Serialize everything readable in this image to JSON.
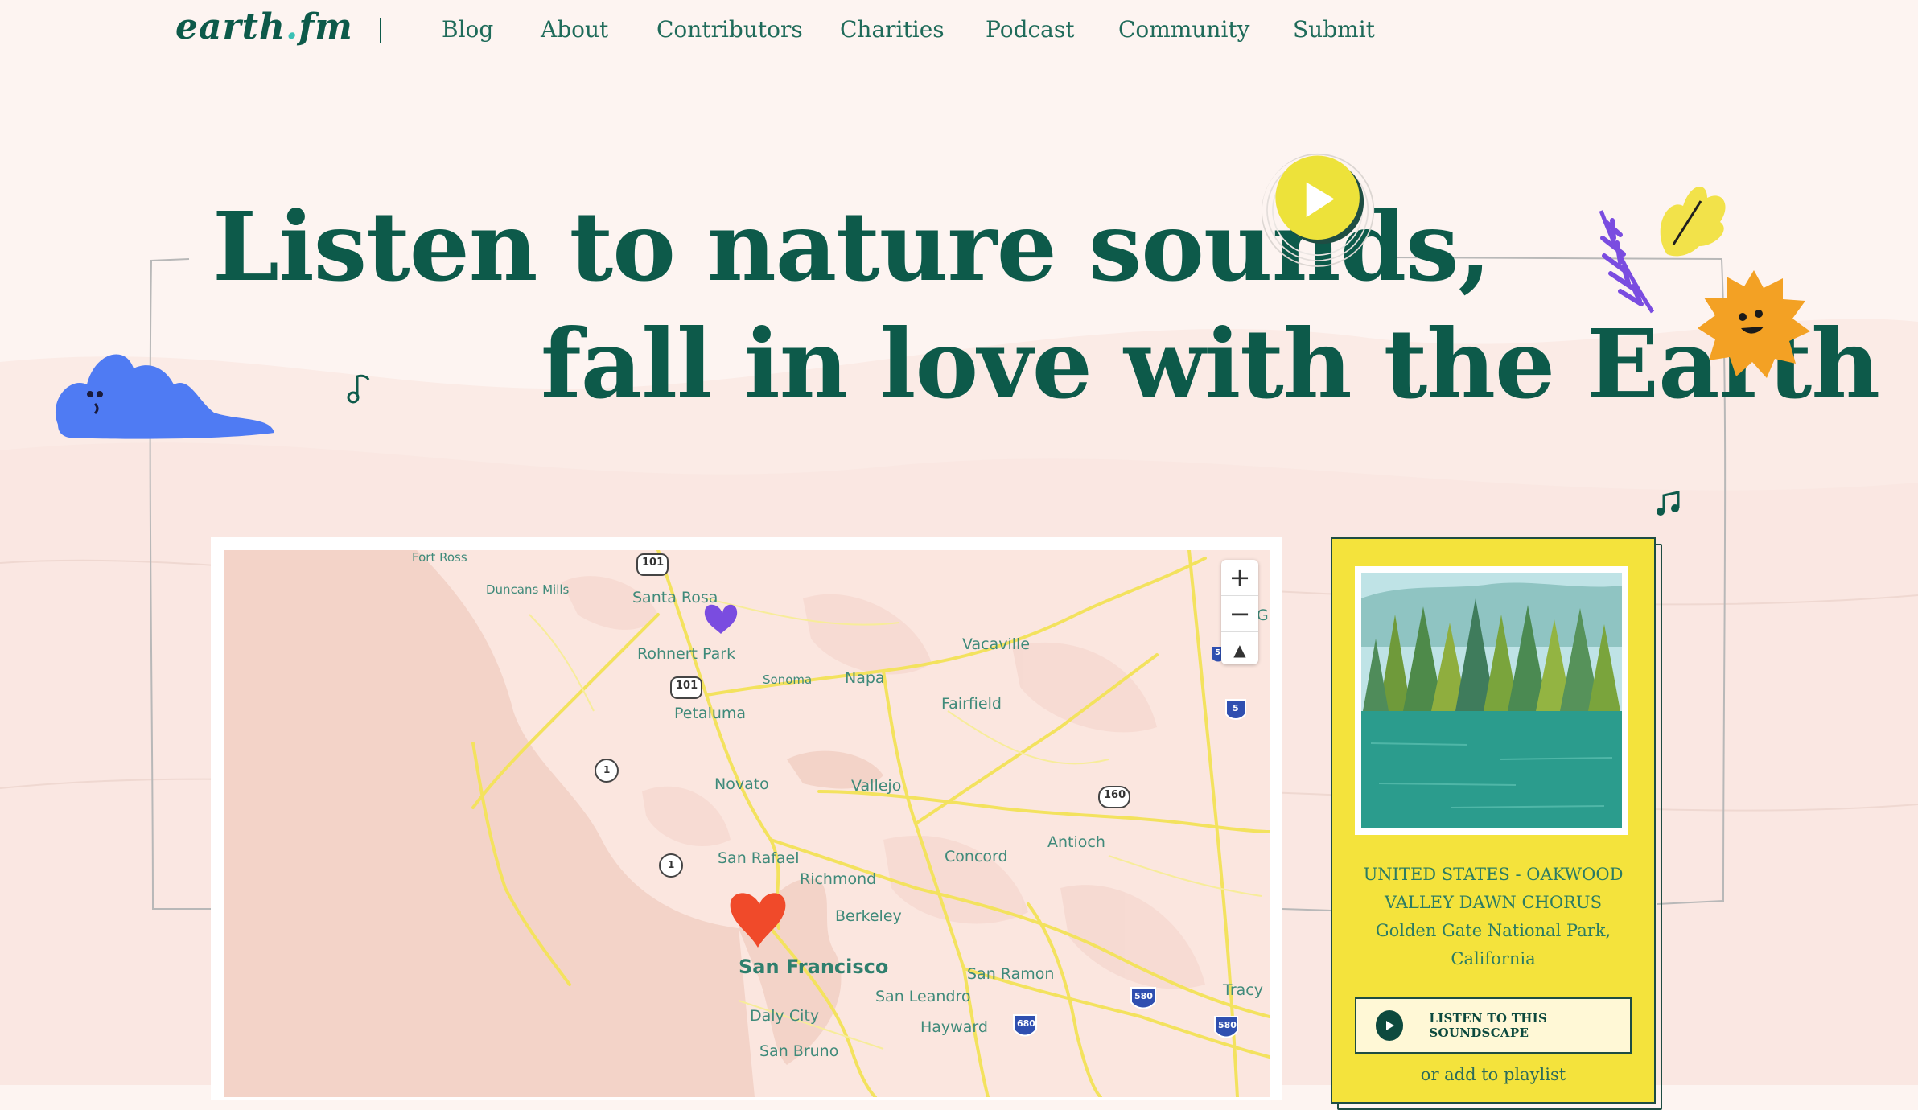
{
  "nav": {
    "logo_main": "earth",
    "logo_dot": ".",
    "logo_tail": "fm",
    "links": [
      "Blog",
      "About",
      "Contributors",
      "Charities",
      "Podcast",
      "Community",
      "Submit"
    ]
  },
  "hero": {
    "line1": "Listen to nature sounds,",
    "line2": "fall in love with the Earth"
  },
  "map": {
    "labels": [
      "Fort Ross",
      "Duncans Mills",
      "Santa Rosa",
      "Rohnert Park",
      "Sonoma",
      "Napa",
      "Vacaville",
      "Petaluma",
      "Fairfield",
      "Novato",
      "Vallejo",
      "Antioch",
      "San Rafael",
      "Richmond",
      "Concord",
      "Berkeley",
      "San Francisco",
      "San Ramon",
      "San Leandro",
      "Daly City",
      "Hayward",
      "Tracy",
      "San Bruno",
      "Gr"
    ],
    "shields": [
      "101",
      "101",
      "1",
      "1",
      "160",
      "5",
      "5",
      "580",
      "680",
      "580"
    ],
    "zoom_in": "+",
    "zoom_out": "−",
    "compass": "▲",
    "colors": {
      "water": "#f3d3c8",
      "land": "#fbe7e1",
      "road": "#f3e25e",
      "pin_purple": "#7a4ce0",
      "pin_red": "#f04a2a"
    }
  },
  "card": {
    "location_line1": "UNITED STATES - OAKWOOD",
    "location_line2": "VALLEY DAWN CHORUS",
    "location_line3": "Golden Gate National Park,",
    "location_line4": "California",
    "listen_button": "LISTEN TO THIS SOUNDSCAPE",
    "playlist_link": "or add to playlist",
    "colors": {
      "background": "#f4e33c",
      "text": "#2b7b63"
    }
  },
  "colors": {
    "page_bg": "#fdf4f1",
    "brand_green": "#0d5a4a",
    "cloud": "#4f7bf3",
    "sun": "#f3a124",
    "leaf_yellow": "#f4e33c",
    "leaf_purple": "#7a4ce0"
  }
}
